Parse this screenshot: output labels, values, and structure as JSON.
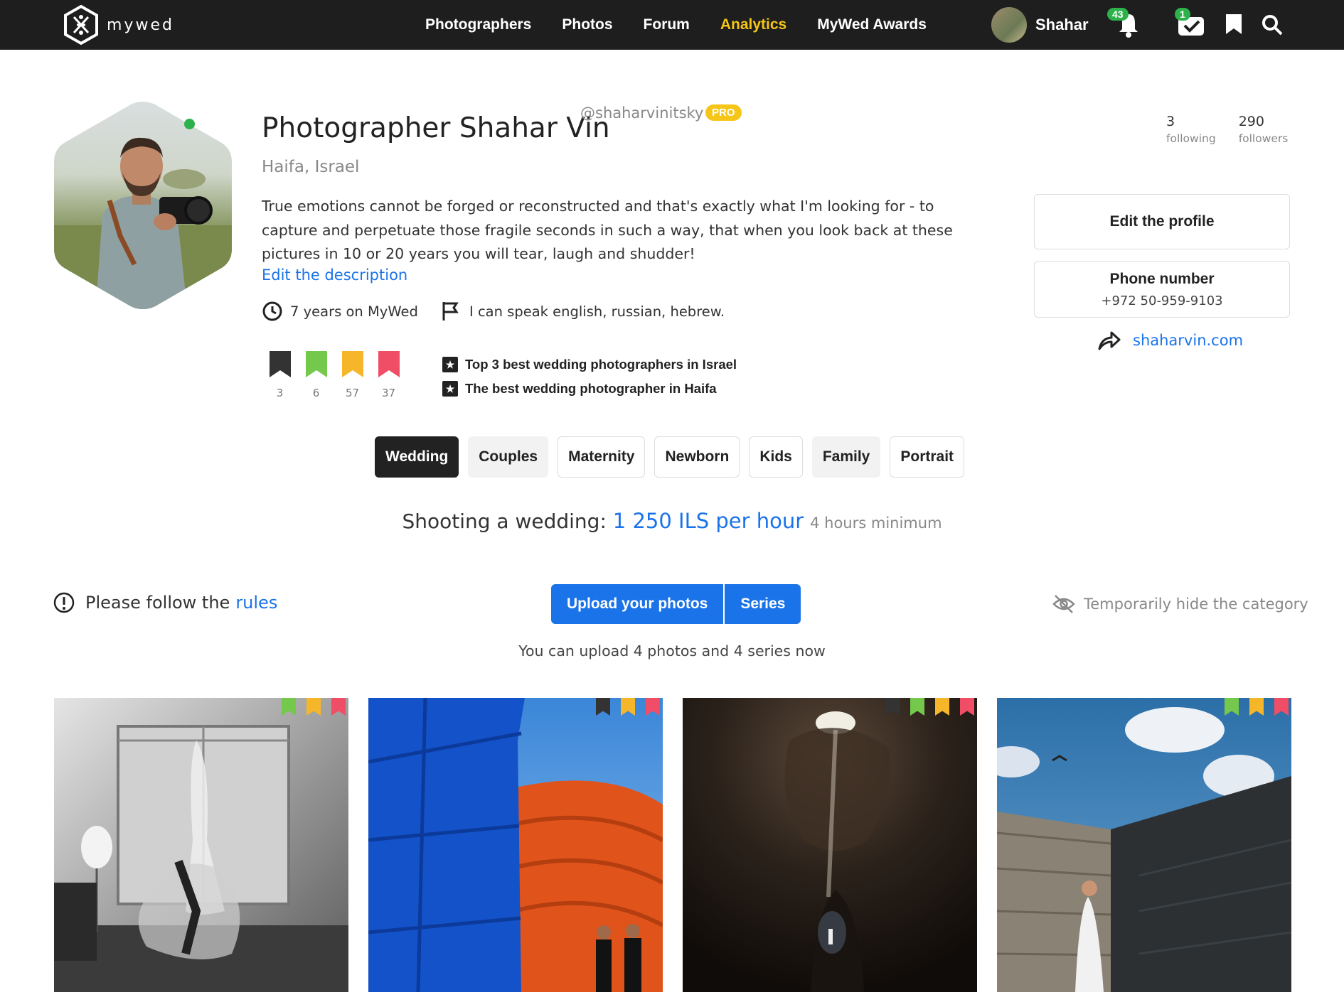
{
  "brand": "mywed",
  "nav": [
    "Photographers",
    "Photos",
    "Forum",
    "Analytics",
    "MyWed Awards"
  ],
  "nav_active": "Analytics",
  "user": {
    "name": "Shahar",
    "notifications": "43",
    "messages": "1"
  },
  "profile": {
    "name": "Photographer Shahar Vin",
    "handle": "@shaharvinitsky",
    "pro_badge": "PRO",
    "location": "Haifa, Israel",
    "description": "True emotions cannot be forged or reconstructed and that's exactly what I'm looking for - to capture and perpetuate those fragile seconds in such a way, that when you look back at these pictures in 10 or 20 years you will tear, laugh and shudder!",
    "edit_description": "Edit the description",
    "years": "7 years on MyWed",
    "languages": "I can speak english, russian, hebrew.",
    "ribbons": [
      {
        "color": "#333333",
        "count": "3"
      },
      {
        "color": "#74c84b",
        "count": "6"
      },
      {
        "color": "#f5b62a",
        "count": "57"
      },
      {
        "color": "#f04e66",
        "count": "37"
      }
    ],
    "awards": [
      "Top 3 best wedding photographers in Israel",
      "The best wedding photographer in Haifa"
    ]
  },
  "stats": {
    "following_count": "3",
    "following_label": "following",
    "followers_count": "290",
    "followers_label": "followers"
  },
  "actions": {
    "edit_profile": "Edit the profile",
    "phone_label": "Phone number",
    "phone_value": "+972 50-959-9103",
    "website": "shaharvin.com"
  },
  "categories": [
    "Wedding",
    "Couples",
    "Maternity",
    "Newborn",
    "Kids",
    "Family",
    "Portrait"
  ],
  "active_category": "Wedding",
  "price": {
    "label": "Shooting a wedding:",
    "amount": "1 250 ILS per hour",
    "minimum": "4 hours minimum"
  },
  "rules": {
    "text": "Please follow the",
    "link": "rules"
  },
  "upload": {
    "button": "Upload your photos",
    "series": "Series",
    "note": "You can upload 4 photos and 4 series now"
  },
  "hide_category": "Temporarily hide the category",
  "colors": {
    "link": "#1a73e8",
    "accent": "#f5c518",
    "topbar": "#1e1e1e",
    "online": "#2db14a"
  }
}
